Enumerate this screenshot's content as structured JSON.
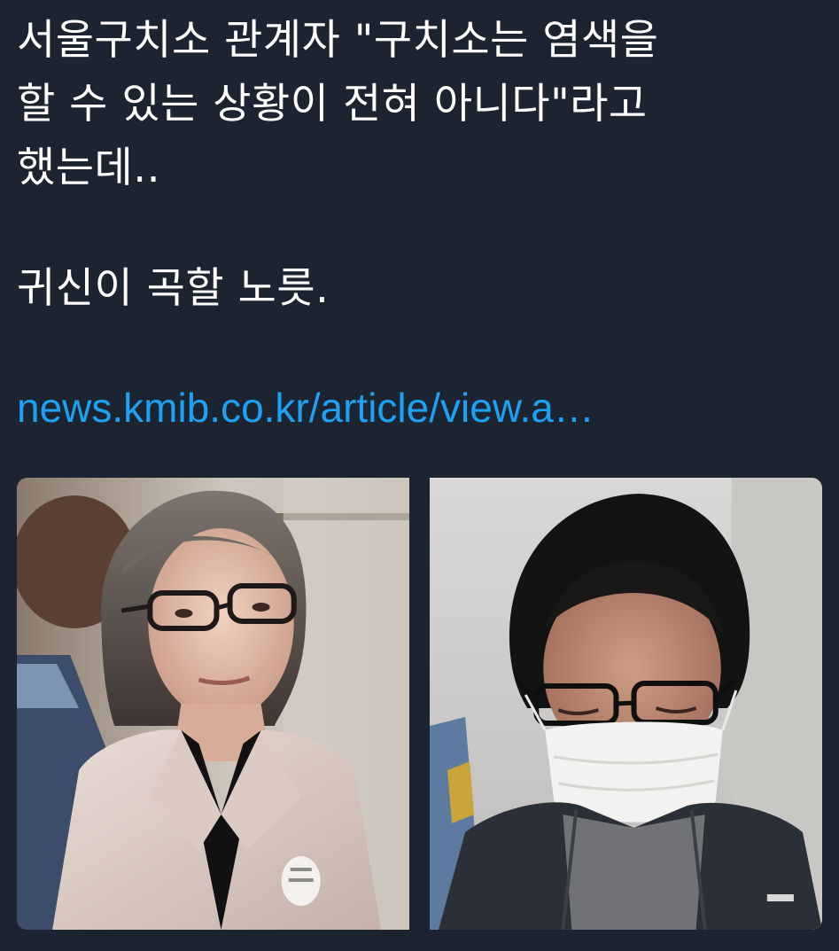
{
  "tweet": {
    "text_lines": [
      "서울구치소 관계자 \"구치소는 염색을",
      "할 수 있는 상황이 전혀 아니다\"라고",
      "했는데..",
      "귀신이 곡할 노릇."
    ],
    "link": "news.kmib.co.kr/article/view.a…"
  },
  "colors": {
    "background": "#1b2430",
    "text": "#ffffff",
    "link": "#1da1f2"
  },
  "media": {
    "photos": [
      {
        "label": "photo-1"
      },
      {
        "label": "photo-2"
      }
    ]
  }
}
